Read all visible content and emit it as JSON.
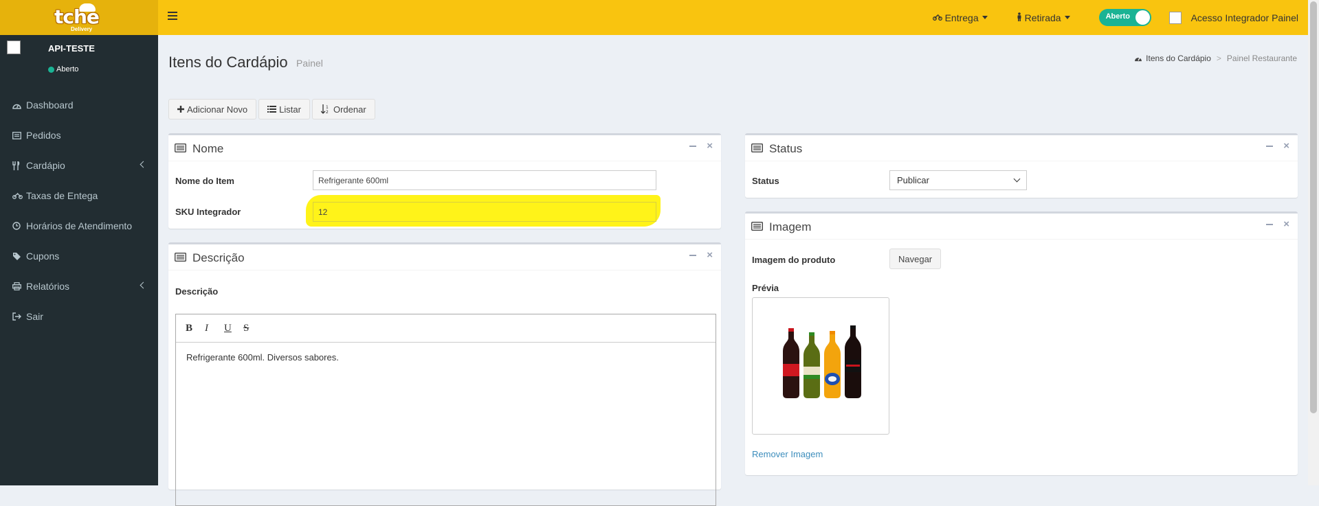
{
  "brand": {
    "logo_text": "tche",
    "logo_sub": "Delivery"
  },
  "topbar": {
    "delivery_label": "Entrega",
    "pickup_label": "Retirada",
    "open_toggle_label": "Aberto",
    "integrator_label": "Acesso Integrador Painel"
  },
  "sidebar": {
    "store_name": "API-TESTE",
    "status": "Aberto",
    "items": [
      {
        "label": "Dashboard",
        "icon": "dashboard-icon"
      },
      {
        "label": "Pedidos",
        "icon": "list-icon"
      },
      {
        "label": "Cardápio",
        "icon": "cutlery-icon",
        "has_children": true
      },
      {
        "label": "Taxas de Entega",
        "icon": "motorcycle-icon"
      },
      {
        "label": "Horários de Atendimento",
        "icon": "clock-icon"
      },
      {
        "label": "Cupons",
        "icon": "tags-icon"
      },
      {
        "label": "Relatórios",
        "icon": "print-icon",
        "has_children": true
      },
      {
        "label": "Sair",
        "icon": "sign-out-icon"
      }
    ]
  },
  "header": {
    "title": "Itens do Cardápio",
    "subtitle": "Painel",
    "breadcrumb": {
      "current": "Itens do Cardápio",
      "parent": "Painel Restaurante"
    }
  },
  "actions": {
    "add_new": "Adicionar Novo",
    "list": "Listar",
    "order": "Ordenar"
  },
  "name_box": {
    "title": "Nome",
    "item_name_label": "Nome do Item",
    "item_name_value": "Refrigerante 600ml",
    "sku_label": "SKU Integrador",
    "sku_value": "12"
  },
  "description_box": {
    "title": "Descrição",
    "field_label": "Descrição",
    "content": "Refrigerante 600ml. Diversos sabores.",
    "toolbar": [
      "B",
      "I",
      "U",
      "S"
    ]
  },
  "status_box": {
    "title": "Status",
    "field_label": "Status",
    "selected": "Publicar"
  },
  "image_box": {
    "title": "Imagem",
    "field_label": "Imagem do produto",
    "browse_button": "Navegar",
    "preview_label": "Prévia",
    "remove_link": "Remover Imagem"
  },
  "colors": {
    "topbar": "#f9c40f",
    "sidebar": "#222d32",
    "accent_green": "#1ab394",
    "link": "#3c8dbc",
    "highlight": "#fff200"
  }
}
